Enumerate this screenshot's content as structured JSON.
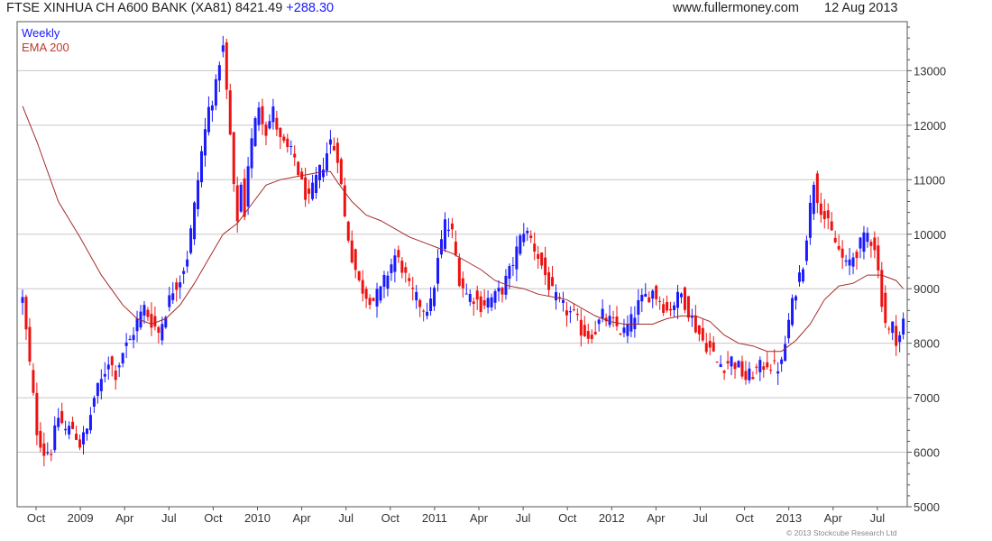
{
  "header": {
    "index_name": "FTSE XINHUA CH A600 BANK (XA81)",
    "last_price": "8421.49",
    "change": "+288.30",
    "website": "www.fullermoney.com",
    "date": "12 Aug 2013"
  },
  "copyright": "© 2013 Stockcube Research Ltd",
  "colors": {
    "up_candle": "#1a1aff",
    "down_candle": "#ee1111",
    "ema_line": "#a52a2a",
    "grid": "#c8c8c8",
    "frame": "#555555"
  },
  "chart_data": {
    "type": "candlestick",
    "interval_label": "Weekly",
    "overlay_label": "EMA 200",
    "ylim": [
      5000,
      13900
    ],
    "y_ticks": [
      5000,
      6000,
      7000,
      8000,
      9000,
      10000,
      11000,
      12000,
      13000
    ],
    "x_ticks": [
      "Oct",
      "2009",
      "Apr",
      "Jul",
      "Oct",
      "2010",
      "Apr",
      "Jul",
      "Oct",
      "2011",
      "Apr",
      "Jul",
      "Oct",
      "2012",
      "Apr",
      "Jul",
      "Oct",
      "2013",
      "Apr",
      "Jul"
    ],
    "price_path": [
      [
        0,
        8800
      ],
      [
        2,
        7600
      ],
      [
        4,
        6400
      ],
      [
        6,
        6000
      ],
      [
        8,
        6050
      ],
      [
        10,
        6650
      ],
      [
        12,
        6400
      ],
      [
        14,
        6450
      ],
      [
        16,
        6150
      ],
      [
        18,
        6400
      ],
      [
        20,
        7000
      ],
      [
        22,
        7300
      ],
      [
        24,
        7700
      ],
      [
        26,
        7450
      ],
      [
        28,
        7850
      ],
      [
        30,
        8050
      ],
      [
        32,
        8400
      ],
      [
        34,
        8650
      ],
      [
        36,
        8400
      ],
      [
        38,
        8200
      ],
      [
        40,
        8600
      ],
      [
        42,
        9000
      ],
      [
        44,
        9200
      ],
      [
        46,
        9600
      ],
      [
        48,
        10500
      ],
      [
        50,
        11500
      ],
      [
        52,
        12300
      ],
      [
        54,
        12700
      ],
      [
        55,
        13200
      ],
      [
        56,
        13400
      ],
      [
        57,
        12600
      ],
      [
        58,
        11800
      ],
      [
        59,
        10800
      ],
      [
        60,
        10300
      ],
      [
        61,
        10900
      ],
      [
        62,
        10400
      ],
      [
        63,
        11300
      ],
      [
        64,
        11700
      ],
      [
        66,
        12400
      ],
      [
        68,
        11900
      ],
      [
        70,
        12250
      ],
      [
        72,
        11700
      ],
      [
        74,
        11550
      ],
      [
        76,
        11400
      ],
      [
        78,
        10900
      ],
      [
        80,
        10600
      ],
      [
        82,
        11000
      ],
      [
        84,
        11300
      ],
      [
        86,
        11700
      ],
      [
        88,
        11450
      ],
      [
        90,
        10300
      ],
      [
        92,
        9600
      ],
      [
        94,
        9100
      ],
      [
        96,
        8900
      ],
      [
        98,
        8800
      ],
      [
        100,
        8950
      ],
      [
        102,
        9300
      ],
      [
        104,
        9600
      ],
      [
        106,
        9400
      ],
      [
        108,
        9000
      ],
      [
        110,
        8800
      ],
      [
        112,
        8650
      ],
      [
        114,
        8700
      ],
      [
        116,
        9500
      ],
      [
        118,
        10200
      ],
      [
        120,
        10000
      ],
      [
        122,
        9200
      ],
      [
        124,
        8900
      ],
      [
        126,
        8850
      ],
      [
        128,
        8700
      ],
      [
        130,
        8800
      ],
      [
        132,
        8850
      ],
      [
        134,
        9000
      ],
      [
        136,
        9300
      ],
      [
        138,
        9700
      ],
      [
        140,
        10100
      ],
      [
        142,
        9900
      ],
      [
        144,
        9600
      ],
      [
        146,
        9250
      ],
      [
        148,
        8900
      ],
      [
        150,
        8700
      ],
      [
        152,
        8600
      ],
      [
        154,
        8500
      ],
      [
        156,
        8250
      ],
      [
        158,
        8150
      ],
      [
        160,
        8250
      ],
      [
        162,
        8500
      ],
      [
        164,
        8400
      ],
      [
        166,
        8300
      ],
      [
        168,
        8200
      ],
      [
        170,
        8400
      ],
      [
        172,
        8700
      ],
      [
        174,
        8850
      ],
      [
        176,
        8950
      ],
      [
        178,
        8800
      ],
      [
        180,
        8600
      ],
      [
        182,
        8750
      ],
      [
        184,
        8900
      ],
      [
        186,
        8600
      ],
      [
        188,
        8300
      ],
      [
        190,
        8050
      ],
      [
        192,
        7900
      ],
      [
        194,
        7650
      ],
      [
        196,
        7600
      ],
      [
        198,
        7700
      ],
      [
        200,
        7550
      ],
      [
        202,
        7350
      ],
      [
        204,
        7450
      ],
      [
        206,
        7550
      ],
      [
        208,
        7650
      ],
      [
        210,
        7550
      ],
      [
        212,
        7600
      ],
      [
        214,
        8400
      ],
      [
        216,
        9000
      ],
      [
        218,
        9500
      ],
      [
        220,
        10500
      ],
      [
        221,
        11000
      ],
      [
        222,
        10700
      ],
      [
        224,
        10300
      ],
      [
        226,
        10000
      ],
      [
        228,
        9700
      ],
      [
        230,
        9400
      ],
      [
        232,
        9600
      ],
      [
        234,
        9800
      ],
      [
        236,
        10000
      ],
      [
        238,
        9800
      ],
      [
        239,
        9300
      ],
      [
        240,
        8800
      ],
      [
        241,
        8400
      ],
      [
        242,
        8200
      ],
      [
        243,
        8300
      ],
      [
        244,
        8100
      ],
      [
        245,
        8150
      ],
      [
        246,
        8400
      ]
    ],
    "ema_path": [
      [
        0,
        12350
      ],
      [
        4,
        11700
      ],
      [
        10,
        10600
      ],
      [
        16,
        9950
      ],
      [
        22,
        9250
      ],
      [
        28,
        8700
      ],
      [
        32,
        8450
      ],
      [
        36,
        8350
      ],
      [
        40,
        8450
      ],
      [
        44,
        8700
      ],
      [
        48,
        9100
      ],
      [
        52,
        9550
      ],
      [
        56,
        10000
      ],
      [
        60,
        10200
      ],
      [
        64,
        10550
      ],
      [
        68,
        10900
      ],
      [
        72,
        11000
      ],
      [
        76,
        11050
      ],
      [
        80,
        11100
      ],
      [
        84,
        11150
      ],
      [
        86,
        11150
      ],
      [
        88,
        10950
      ],
      [
        92,
        10600
      ],
      [
        96,
        10350
      ],
      [
        100,
        10250
      ],
      [
        104,
        10100
      ],
      [
        108,
        9950
      ],
      [
        112,
        9850
      ],
      [
        116,
        9750
      ],
      [
        120,
        9650
      ],
      [
        124,
        9500
      ],
      [
        128,
        9350
      ],
      [
        132,
        9150
      ],
      [
        136,
        9050
      ],
      [
        140,
        9000
      ],
      [
        144,
        8900
      ],
      [
        148,
        8850
      ],
      [
        152,
        8800
      ],
      [
        156,
        8650
      ],
      [
        160,
        8500
      ],
      [
        164,
        8400
      ],
      [
        168,
        8350
      ],
      [
        172,
        8350
      ],
      [
        176,
        8350
      ],
      [
        180,
        8450
      ],
      [
        184,
        8500
      ],
      [
        188,
        8500
      ],
      [
        192,
        8400
      ],
      [
        196,
        8150
      ],
      [
        200,
        8000
      ],
      [
        204,
        7950
      ],
      [
        208,
        7850
      ],
      [
        212,
        7850
      ],
      [
        216,
        8050
      ],
      [
        220,
        8350
      ],
      [
        224,
        8800
      ],
      [
        228,
        9050
      ],
      [
        232,
        9100
      ],
      [
        236,
        9250
      ],
      [
        240,
        9250
      ],
      [
        244,
        9150
      ],
      [
        246,
        9000
      ]
    ]
  }
}
